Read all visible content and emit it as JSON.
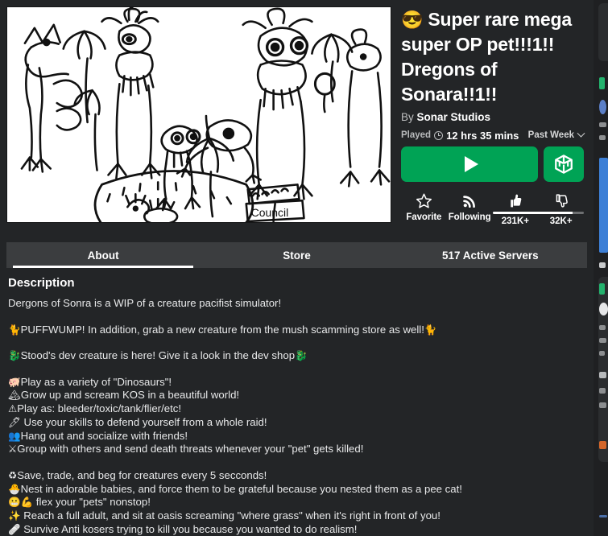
{
  "theme": {
    "page_bg": "#232527",
    "tabbar_bg": "#3b3d3f",
    "accent_green": "#00a355",
    "text_primary": "#ffffff",
    "text_secondary": "#b9bbbd"
  },
  "thumbnail": {
    "alt": "Hand drawn black and white doodle of long necked dinosaur creatures standing around a nest, with a sign reading Council",
    "sign_text": "Council"
  },
  "header": {
    "title_emoji": "😎",
    "title": "Super rare mega super OP pet!!!1!! Dregons of Sonara!!1!!",
    "by_prefix": "By",
    "creator": "Sonar Studios"
  },
  "stats": {
    "played_label": "Played",
    "clock_icon": "clock-icon",
    "played_value": "12 hrs 35 mins",
    "period": "Past Week",
    "period_chevron": "chevron-down-icon"
  },
  "actions": {
    "play_icon": "play-icon",
    "play_label": "",
    "inventory_icon": "cube-icon",
    "favorite_icon": "star-icon",
    "favorite_label": "Favorite",
    "following_icon": "rss-icon",
    "following_label": "Following",
    "thumbs_up_icon": "thumbs-up-icon",
    "thumbs_down_icon": "thumbs-down-icon",
    "likes": "231K+",
    "dislikes": "32K+",
    "like_ratio_percent": 88
  },
  "tabs": [
    {
      "label": "About",
      "active": true
    },
    {
      "label": "Store",
      "active": false
    },
    {
      "label": "517 Active Servers",
      "active": false
    }
  ],
  "description": {
    "heading": "Description",
    "intro": "Dergons of Sonra is a WIP of a creature pacifist simulator!",
    "notes": [
      {
        "emoji_left": "🐈",
        "text": "PUFFWUMP! In addition, grab a new creature from the mush scamming store as well!",
        "emoji_right": "🐈"
      },
      {
        "emoji_left": "🐉",
        "text": "Stood's dev creature is here! Give it a look in the dev shop",
        "emoji_right": "🐉"
      }
    ],
    "features": [
      {
        "emoji": "🐖",
        "text": "Play as a variety of \"Dinosaurs\"!"
      },
      {
        "emoji": "🏔",
        "text": "Grow up and scream KOS in a beautiful world!"
      },
      {
        "emoji": "⚠",
        "text": "Play as: bleeder/toxic/tank/flier/etc!"
      },
      {
        "emoji": "🖊",
        "text": " Use your skills to defend yourself from a whole raid!"
      },
      {
        "emoji": "👥",
        "text": "Hang out and socialize with friends!"
      },
      {
        "emoji": "⚔",
        "text": "Group with others and send death threats whenever your \"pet\" gets killed!"
      }
    ],
    "features2": [
      {
        "emoji": "♻",
        "text": "Save, trade, and beg for creatures every 5 secconds!"
      },
      {
        "emoji": "🐣",
        "text": "Nest in adorable babies, and force them to be grateful because you nested them as a pee cat!"
      },
      {
        "emoji": "😬💪",
        "text": " flex your \"pets\" nonstop!"
      },
      {
        "emoji": "✨",
        "text": " Reach a full adult, and sit at oasis screaming \"where grass\" when it's right in front of you!"
      },
      {
        "emoji": "🩹",
        "text": " Survive Anti kosers trying to kill you because you wanted to do realism!"
      }
    ]
  }
}
